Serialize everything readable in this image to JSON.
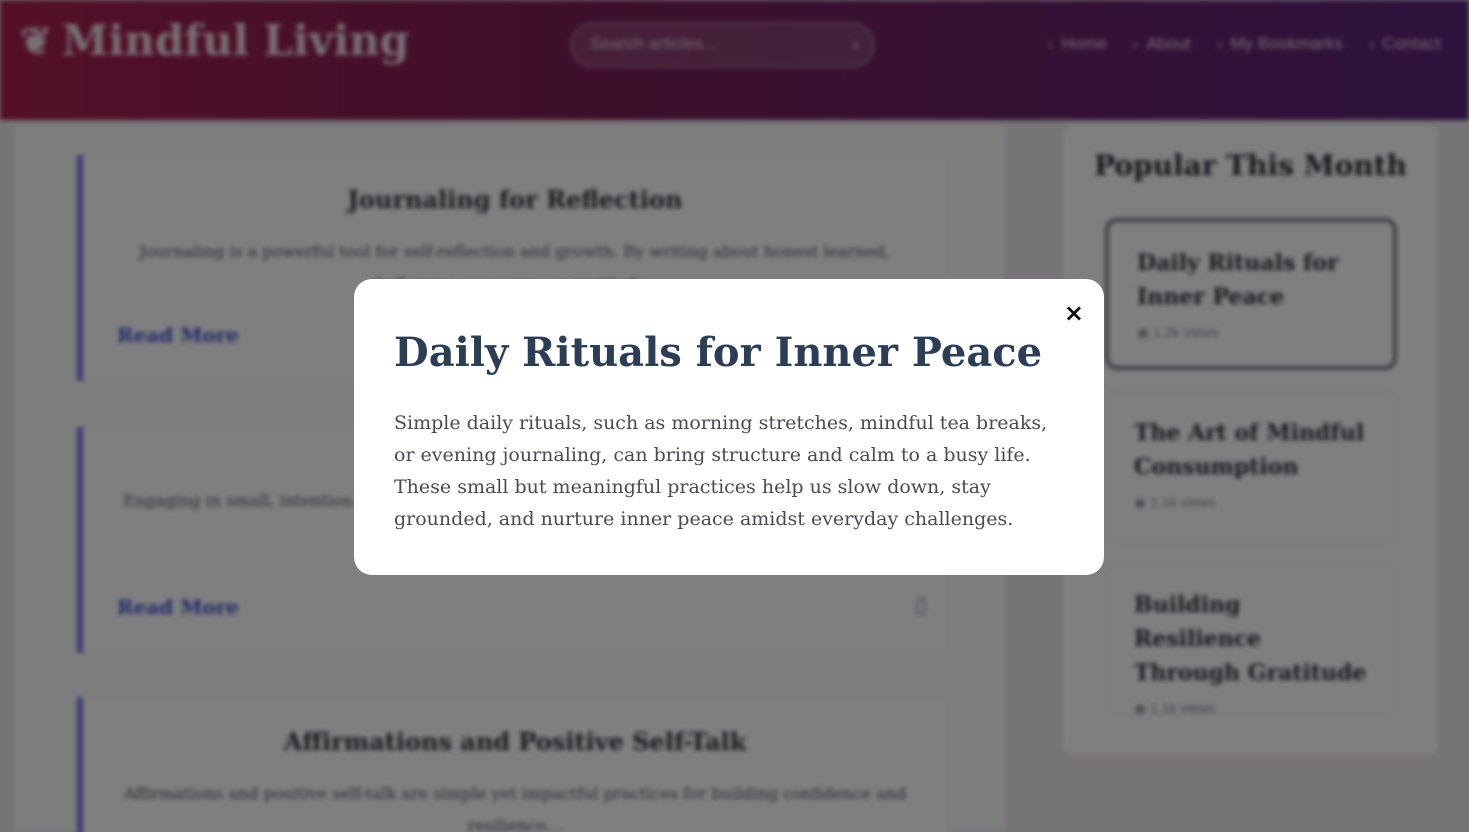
{
  "header": {
    "logo_icon": "leaf-icon",
    "logo_text": "Mindful Living",
    "search_placeholder": "Search articles...",
    "nav": [
      "Home",
      "About",
      "My Bookmarks",
      "Contact"
    ]
  },
  "articles": [
    {
      "title": "Journaling for Reflection",
      "excerpt": "Journaling is a powerful tool for self-reflection and growth. By writing about honest learned, challenges overcome, or gratitude…",
      "read_more": "Read More"
    },
    {
      "title": "",
      "excerpt": "Engaging in small, intention…",
      "read_more": "Read More"
    },
    {
      "title": "Affirmations and Positive Self-Talk",
      "excerpt": "Affirmations and positive self-talk are simple yet impactful practices for building confidence and resilience…",
      "read_more": ""
    }
  ],
  "sidebar": {
    "title": "Popular This Month",
    "items": [
      {
        "title": "Daily Rituals for Inner Peace",
        "views": "1.2k views"
      },
      {
        "title": "The Art of Mindful Consumption",
        "views": "1.1k views"
      },
      {
        "title": "Building Resilience Through Gratitude",
        "views": "1.1k views"
      }
    ]
  },
  "modal": {
    "title": "Daily Rituals for Inner Peace",
    "body": "Simple daily rituals, such as morning stretches, mindful tea breaks, or evening journaling, can bring structure and calm to a busy life. These small but meaningful practices help us slow down, stay grounded, and nurture inner peace amidst everyday challenges.",
    "close": "×"
  },
  "colors": {
    "header_start": "#a81f4f",
    "header_end": "#5a2479",
    "accent": "#6b7fe3",
    "modal_title": "#2c3e55"
  }
}
